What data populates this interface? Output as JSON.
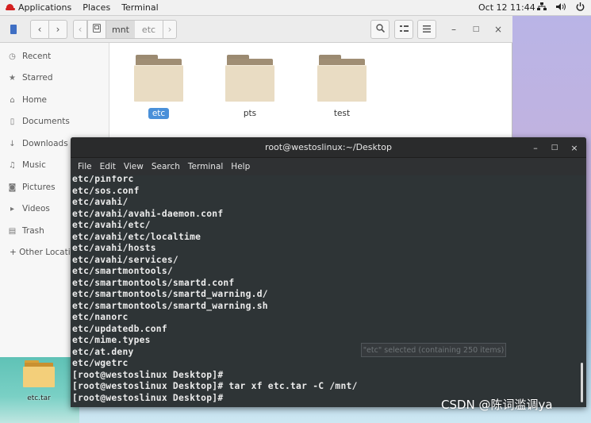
{
  "topbar": {
    "applications": "Applications",
    "places": "Places",
    "terminal": "Terminal",
    "clock": "Oct 12  11:44"
  },
  "files": {
    "path": [
      "mnt",
      "etc"
    ],
    "sidebar": [
      {
        "label": "Recent",
        "icon": "clock-icon"
      },
      {
        "label": "Starred",
        "icon": "star-icon"
      },
      {
        "label": "Home",
        "icon": "home-icon"
      },
      {
        "label": "Documents",
        "icon": "document-icon"
      },
      {
        "label": "Downloads",
        "icon": "download-icon"
      },
      {
        "label": "Music",
        "icon": "music-icon"
      },
      {
        "label": "Pictures",
        "icon": "camera-icon"
      },
      {
        "label": "Videos",
        "icon": "video-icon"
      },
      {
        "label": "Trash",
        "icon": "trash-icon"
      },
      {
        "label": "+ Other Locatio",
        "icon": "plus-icon"
      }
    ],
    "folders": [
      {
        "name": "etc",
        "selected": true
      },
      {
        "name": "pts",
        "selected": false
      },
      {
        "name": "test",
        "selected": false
      }
    ],
    "status": "\"etc\" selected  (containing 250 items)"
  },
  "terminal": {
    "title": "root@westoslinux:~/Desktop",
    "menu": [
      "File",
      "Edit",
      "View",
      "Search",
      "Terminal",
      "Help"
    ],
    "lines": [
      "etc/pinforc",
      "etc/sos.conf",
      "etc/avahi/",
      "etc/avahi/avahi-daemon.conf",
      "etc/avahi/etc/",
      "etc/avahi/etc/localtime",
      "etc/avahi/hosts",
      "etc/avahi/services/",
      "etc/smartmontools/",
      "etc/smartmontools/smartd.conf",
      "etc/smartmontools/smartd_warning.d/",
      "etc/smartmontools/smartd_warning.sh",
      "etc/nanorc",
      "etc/updatedb.conf",
      "etc/mime.types",
      "etc/at.deny",
      "etc/wgetrc",
      "[root@westoslinux Desktop]#",
      "[root@westoslinux Desktop]# tar xf etc.tar -C /mnt/",
      "[root@westoslinux Desktop]#"
    ]
  },
  "desktop": {
    "icon_label": "etc.tar"
  },
  "watermark": "CSDN @陈词滥调ya"
}
